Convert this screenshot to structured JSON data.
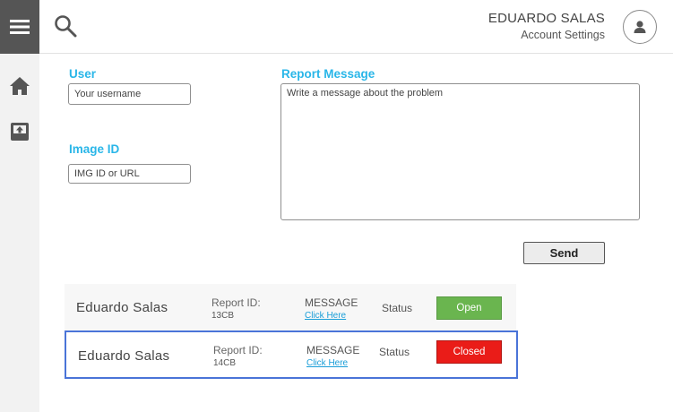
{
  "header": {
    "user_name": "EDUARDO SALAS",
    "account_settings": "Account Settings"
  },
  "sidebar": {
    "items": [
      {
        "icon": "menu-icon"
      },
      {
        "icon": "home-icon"
      },
      {
        "icon": "upload-icon"
      }
    ]
  },
  "form": {
    "user_label": "User",
    "user_placeholder": "Your username",
    "image_label": "Image ID",
    "image_placeholder": "IMG ID or URL",
    "message_label": "Report Message",
    "message_placeholder": "Write a message about the problem",
    "send_label": "Send"
  },
  "reports": [
    {
      "name": "Eduardo Salas",
      "id_label": "Report ID:",
      "id_value": "13CB",
      "message_label": "MESSAGE",
      "link": "Click Here",
      "status_label": "Status",
      "status": "Open",
      "status_color": "#6ab54f",
      "selected": false
    },
    {
      "name": "Eduardo Salas",
      "id_label": "Report ID:",
      "id_value": "14CB",
      "message_label": "MESSAGE",
      "link": "Click Here",
      "status_label": "Status",
      "status": "Closed",
      "status_color": "#ea1c18",
      "selected": true
    }
  ],
  "colors": {
    "accent": "#29b6e8",
    "sidebar_active": "#555555",
    "selection_border": "#4a74d8"
  }
}
